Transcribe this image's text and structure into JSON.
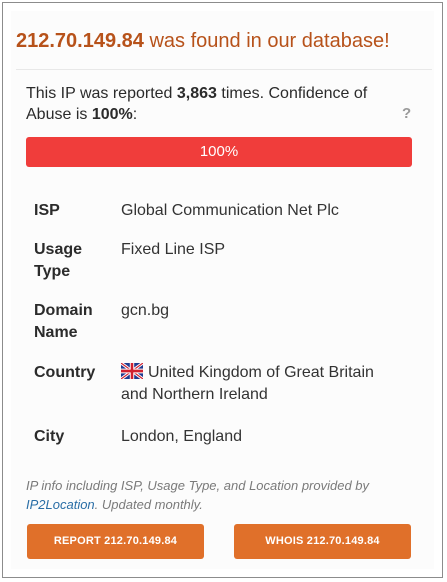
{
  "headline": {
    "ip": "212.70.149.84",
    "suffix": " was found in our database!"
  },
  "report": {
    "prefix": "This IP was reported ",
    "count": "3,863",
    "middle": " times. Confidence of Abuse is ",
    "confidence": "100%",
    "end": ":"
  },
  "help_label": "?",
  "confidence_bar": {
    "label": "100%",
    "value_percent": 100,
    "fill_color": "#f03d3b"
  },
  "info": [
    {
      "label": "ISP",
      "value": "Global Communication Net Plc"
    },
    {
      "label": "Usage Type",
      "value": "Fixed Line ISP"
    },
    {
      "label": "Domain Name",
      "value": "gcn.bg"
    },
    {
      "label": "Country",
      "value": "United Kingdom of Great Britain and Northern Ireland",
      "flag_icon": "uk-flag-icon"
    },
    {
      "label": "City",
      "value": "London, England"
    }
  ],
  "note": {
    "prefix": "IP info including ISP, Usage Type, and Location provided by ",
    "link": "IP2Location",
    "suffix": ". Updated monthly."
  },
  "buttons": {
    "report": "REPORT 212.70.149.84",
    "whois": "WHOIS 212.70.149.84"
  },
  "colors": {
    "accent": "#b7521a",
    "button": "#e0702a",
    "link": "#2a6ea6"
  }
}
